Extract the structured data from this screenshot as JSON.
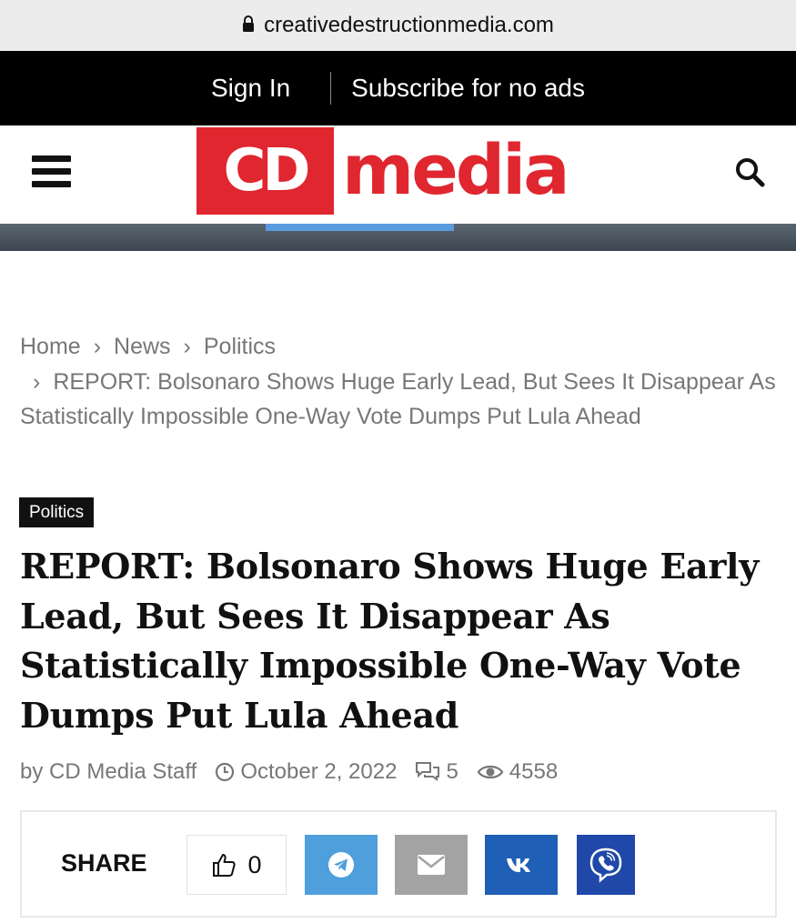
{
  "browser": {
    "url": "creativedestructionmedia.com",
    "lock_icon": "lock-icon"
  },
  "topbar": {
    "sign_in": "Sign In",
    "subscribe": "Subscribe for no ads"
  },
  "header": {
    "menu_icon": "hamburger-icon",
    "logo": {
      "box_text": "CD",
      "word": "media",
      "brand_color": "#e0262f"
    },
    "search_icon": "search-icon"
  },
  "breadcrumb": {
    "items": [
      "Home",
      "News",
      "Politics"
    ],
    "current": "REPORT: Bolsonaro Shows Huge Early Lead, But Sees It Disappear As Statistically Impossible One-Way Vote Dumps Put Lula Ahead"
  },
  "article": {
    "category": "Politics",
    "title": "REPORT: Bolsonaro Shows Huge Early Lead, But Sees It Disappear As Statistically Impossible One-Way Vote Dumps Put Lula Ahead",
    "author": "by CD Media Staff",
    "date": "October 2, 2022",
    "comments": "5",
    "views": "4558"
  },
  "share": {
    "label": "SHARE",
    "likes": "0",
    "buttons": [
      {
        "icon": "telegram-icon",
        "color": "#4f9fdc"
      },
      {
        "icon": "email-icon",
        "color": "#a3a3a3"
      },
      {
        "icon": "vk-icon",
        "color": "#1f5fb6"
      },
      {
        "icon": "viber-icon",
        "color": "#1f48a8"
      }
    ]
  }
}
